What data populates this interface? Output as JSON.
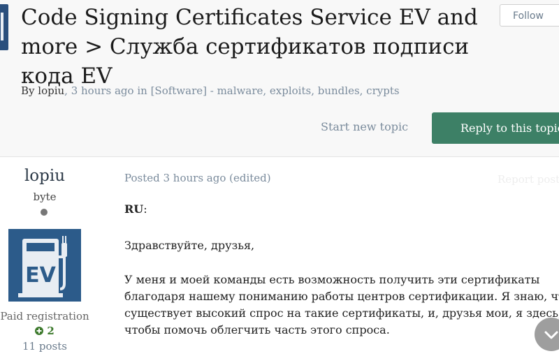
{
  "topic": {
    "title": "Code Signing Certificates Service EV and more > Служба сертификатов подписи кода EV",
    "byline": {
      "prefix": "By ",
      "author": "lopiu",
      "time": ", 3 hours ago in ",
      "forum": "[Software] - malware, exploits, bundles, crypts"
    },
    "follow_label": "Follow"
  },
  "actions": {
    "start_new_topic": "Start new topic",
    "reply": "Reply to this topic"
  },
  "author": {
    "name": "lopiu",
    "rank": "byte",
    "group": "Paid registration",
    "reputation": "2",
    "posts": "11 posts",
    "avatar_text": "EV"
  },
  "post": {
    "meta": "Posted 3 hours ago (edited)",
    "report": "Report post",
    "lang_label": "RU",
    "lang_colon": ":",
    "greeting": "Здравствуйте, друзья,",
    "lines": [
      "У меня и моей команды есть возможность получить эти сертификаты",
      "благодаря нашему пониманию работы центров сертификации. Я знаю, что",
      "существует высокий спрос на такие сертификаты, и, друзья мои, я здесь,",
      "чтобы помочь облегчить часть этого спроса."
    ]
  },
  "colors": {
    "reply_button": "#3d8066",
    "avatar_bg": "#2c5b8a",
    "rep_positive": "#3d7a2d"
  },
  "icons": {
    "rep": "plus-circle-icon",
    "scroll": "chevron-down-icon",
    "status": "offline-dot-icon"
  }
}
